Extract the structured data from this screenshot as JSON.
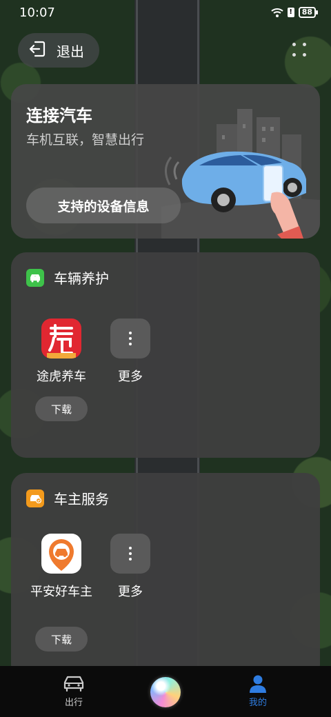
{
  "status_bar": {
    "time": "10:07",
    "battery": "88",
    "alert": "!"
  },
  "header": {
    "exit_label": "退出"
  },
  "connect_card": {
    "title": "连接汽车",
    "subtitle": "车机互联，智慧出行",
    "button_label": "支持的设备信息"
  },
  "vehicle_care": {
    "title": "车辆养护",
    "apps": [
      {
        "label": "途虎养车",
        "icon": "tuhu-logo-icon",
        "action": "下载"
      },
      {
        "label": "更多",
        "icon": "more-vertical-icon"
      }
    ]
  },
  "owner_services": {
    "title": "车主服务",
    "apps": [
      {
        "label": "平安好车主",
        "icon": "pingan-logo-icon",
        "action": "下载"
      },
      {
        "label": "更多",
        "icon": "more-vertical-icon"
      }
    ]
  },
  "bottom_nav": {
    "items": [
      {
        "label": "出行",
        "icon": "car-icon",
        "active": false
      },
      {
        "label": "",
        "icon": "voice-assistant-orb-icon",
        "active": false
      },
      {
        "label": "我的",
        "icon": "person-icon",
        "active": true
      }
    ]
  },
  "colors": {
    "accent_blue": "#2f7de1",
    "card_bg": "#3e3e3e",
    "care_icon_green": "#3ec24a",
    "service_icon_orange": "#f39a1c",
    "tuhu_red": "#e12731"
  }
}
